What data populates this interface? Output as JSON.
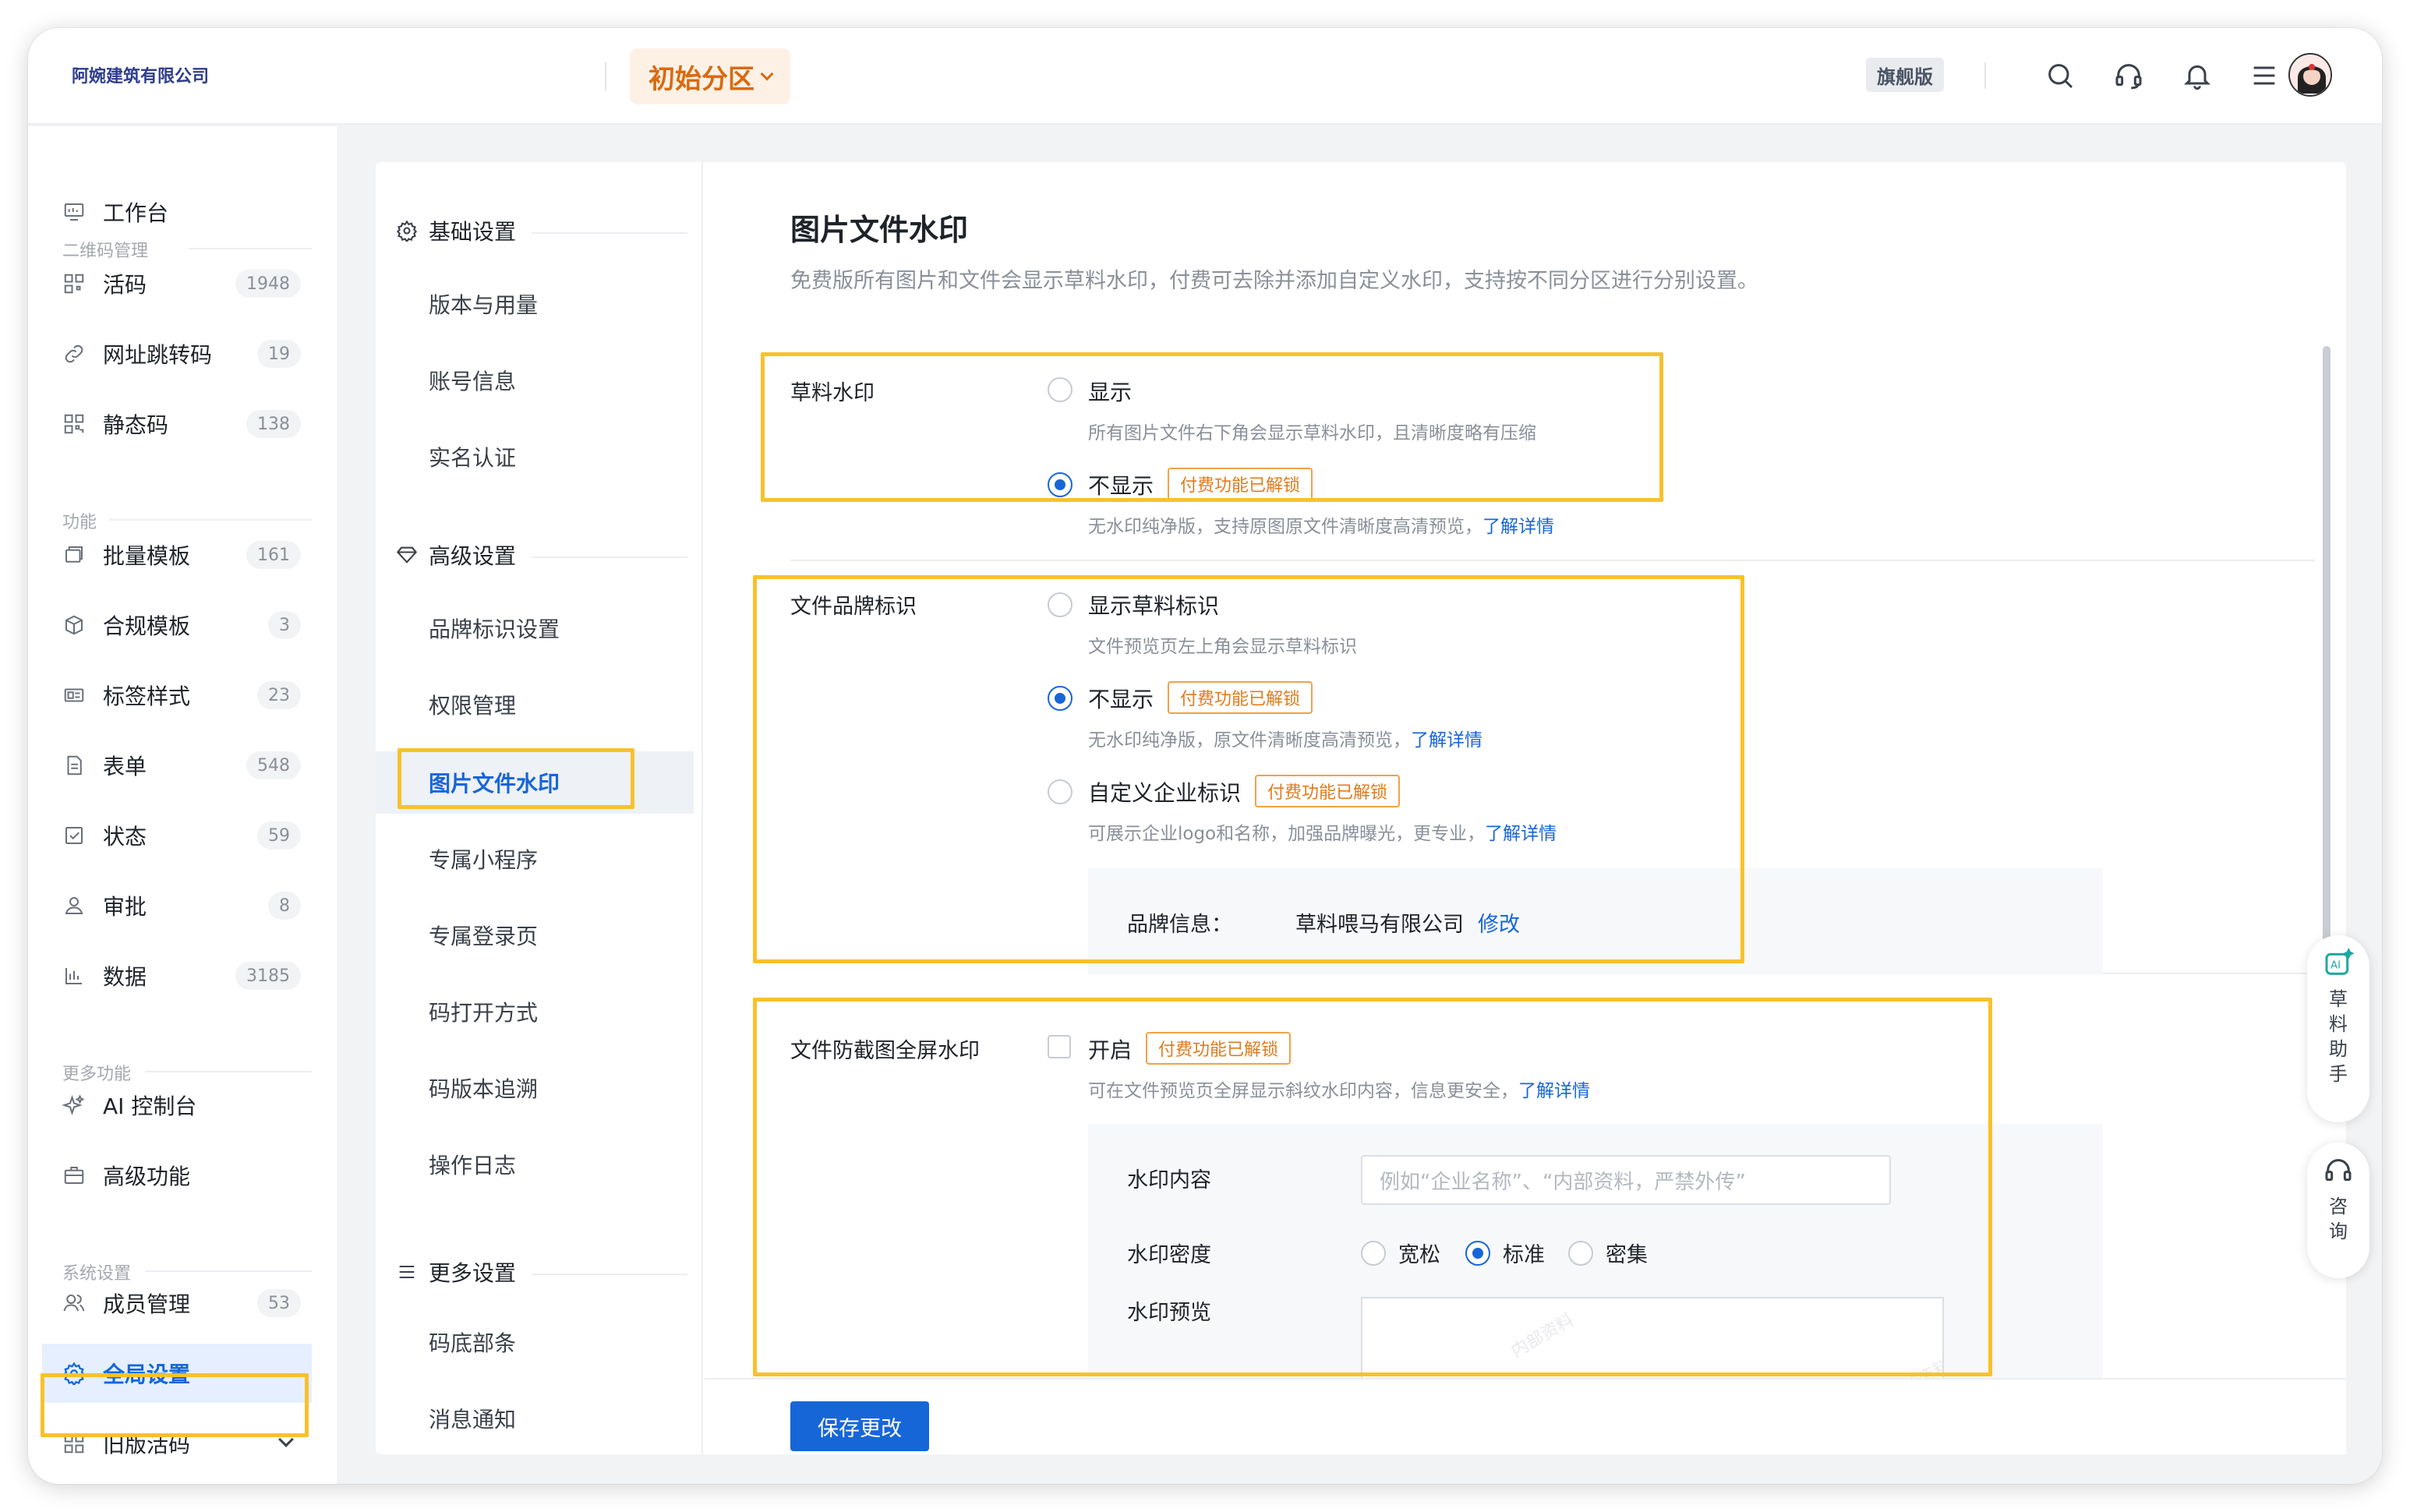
{
  "header": {
    "company": "阿婉建筑有限公司",
    "partition": "初始分区",
    "edition": "旗舰版",
    "icons": [
      "search-icon",
      "headset-icon",
      "bell-icon",
      "menu-icon",
      "avatar"
    ]
  },
  "sidebar": {
    "workbench": "工作台",
    "groups": {
      "qrcode": "二维码管理",
      "features": "功能",
      "more": "更多功能",
      "system": "系统设置"
    },
    "items": [
      {
        "label": "活码",
        "count": "1948",
        "icon": "qrcode-icon"
      },
      {
        "label": "网址跳转码",
        "count": "19",
        "icon": "link-icon"
      },
      {
        "label": "静态码",
        "count": "138",
        "icon": "static-qrcode-icon"
      },
      {
        "label": "批量模板",
        "count": "161",
        "icon": "batch-template-icon"
      },
      {
        "label": "合规模板",
        "count": "3",
        "icon": "cube-icon"
      },
      {
        "label": "标签样式",
        "count": "23",
        "icon": "label-style-icon"
      },
      {
        "label": "表单",
        "count": "548",
        "icon": "form-icon"
      },
      {
        "label": "状态",
        "count": "59",
        "icon": "status-check-icon"
      },
      {
        "label": "审批",
        "count": "8",
        "icon": "approval-user-icon"
      },
      {
        "label": "数据",
        "count": "3185",
        "icon": "bar-chart-icon"
      }
    ],
    "more_items": [
      {
        "label": "AI 控制台",
        "icon": "sparkle-icon"
      },
      {
        "label": "高级功能",
        "icon": "briefcase-icon"
      }
    ],
    "system_items": [
      {
        "label": "成员管理",
        "count": "53",
        "icon": "members-icon"
      },
      {
        "label": "全局设置",
        "icon": "gear-icon"
      },
      {
        "label": "旧版活码",
        "icon": "old-qrcode-icon"
      }
    ]
  },
  "subnav": {
    "basic": "基础设置",
    "basic_items": [
      "版本与用量",
      "账号信息",
      "实名认证"
    ],
    "advanced": "高级设置",
    "advanced_items": [
      "品牌标识设置",
      "权限管理",
      "图片文件水印",
      "专属小程序",
      "专属登录页",
      "码打开方式",
      "码版本追溯",
      "操作日志"
    ],
    "more": "更多设置",
    "more_items": [
      "码底部条",
      "消息通知"
    ]
  },
  "main": {
    "title": "图片文件水印",
    "desc": "免费版所有图片和文件会显示草料水印，付费可去除并添加自定义水印，支持按不同分区进行分别设置。",
    "paid_tag": "付费功能已解锁",
    "learn_more": "了解详情",
    "draft_watermark": {
      "label": "草料水印",
      "show": "显示",
      "show_desc": "所有图片文件右下角会显示草料水印，且清晰度略有压缩",
      "hide": "不显示",
      "hide_desc": "无水印纯净版，支持原图原文件清晰度高清预览，"
    },
    "brand_mark": {
      "label": "文件品牌标识",
      "show": "显示草料标识",
      "show_desc": "文件预览页左上角会显示草料标识",
      "hide": "不显示",
      "hide_desc": "无水印纯净版，原文件清晰度高清预览，",
      "custom": "自定义企业标识",
      "custom_desc": "可展示企业logo和名称，加强品牌曝光，更专业，",
      "brand_info_label": "品牌信息：",
      "brand_info_value": "草料喂马有限公司",
      "edit": "修改"
    },
    "anti_screenshot": {
      "label": "文件防截图全屏水印",
      "enable": "开启",
      "enable_desc": "可在文件预览页全屏显示斜纹水印内容，信息更安全，",
      "content_label": "水印内容",
      "content_placeholder": "例如“企业名称”、“内部资料，严禁外传”",
      "density_label": "水印密度",
      "density_options": [
        "宽松",
        "标准",
        "密集"
      ],
      "density_selected": "标准",
      "preview_label": "水印预览",
      "preview_text": "内部资料"
    },
    "save": "保存更改"
  },
  "float": {
    "assistant": "草料助手",
    "consult": "咨询"
  },
  "colors": {
    "accent": "#1766d8",
    "partition": "#d96a10",
    "tag": "#e07b1c",
    "highlight": "#f8c12c"
  }
}
